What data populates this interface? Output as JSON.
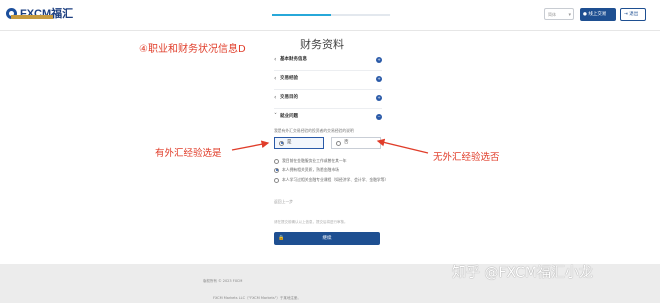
{
  "header": {
    "logo_text": "FXCM福汇",
    "progress_fraction": 0.5,
    "lang_value": "简体",
    "login_label": "线上交易",
    "exit_label": "退出"
  },
  "annotations": {
    "top": "④职业和财务状况信息D",
    "left": "有外汇经验选是",
    "right": "无外汇经验选否"
  },
  "page_title": "财务资料",
  "sections": [
    {
      "label": "基本财务信息"
    },
    {
      "label": "交易经验"
    },
    {
      "label": "交易目的"
    },
    {
      "label": "就业问题"
    }
  ],
  "question": "我是有外汇交易经验的投资者的交易经验的说明",
  "options": {
    "yes": "是",
    "no": "否"
  },
  "radio_rows": [
    "我目前在金融服务业工作或曾在其一年",
    "本人拥有相关资质，熟悉金融市场",
    "本人学习过相关金融专业课程（如经济学、会计学、金融学等）"
  ],
  "link_text": "返回上一步",
  "note_text": "请在提交前确认以上信息，提交后将进行审核。",
  "submit_label": "继续",
  "footer": {
    "copy": "版权所有 © 2023 FXCM",
    "legal": "FXCM Markets LLC（\"FXCM Markets\"）于某地注册。"
  },
  "watermark": "知乎 @FXCM福汇小龙",
  "colors": {
    "brand": "#1e4f91",
    "annotation": "#e03d2a",
    "progress": "#27a8d9"
  }
}
